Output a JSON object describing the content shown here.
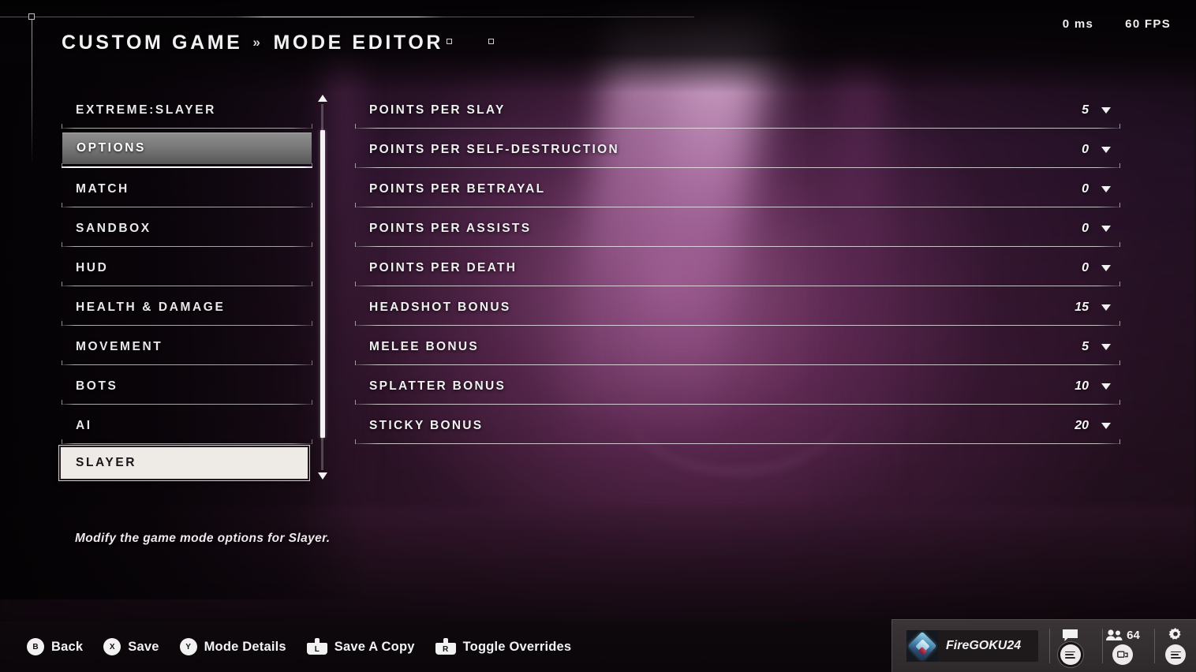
{
  "header": {
    "breadcrumb_root": "CUSTOM GAME",
    "breadcrumb_separator": "»",
    "breadcrumb_current": "MODE EDITOR",
    "latency": "0 ms",
    "framerate": "60 FPS"
  },
  "sidebar": {
    "items": [
      {
        "label": "EXTREME:SLAYER",
        "state": "normal"
      },
      {
        "label": "OPTIONS",
        "state": "hover"
      },
      {
        "label": "MATCH",
        "state": "normal"
      },
      {
        "label": "SANDBOX",
        "state": "normal"
      },
      {
        "label": "HUD",
        "state": "normal"
      },
      {
        "label": "HEALTH & DAMAGE",
        "state": "normal"
      },
      {
        "label": "MOVEMENT",
        "state": "normal"
      },
      {
        "label": "BOTS",
        "state": "normal"
      },
      {
        "label": "AI",
        "state": "normal"
      },
      {
        "label": "SLAYER",
        "state": "selected"
      }
    ],
    "description": "Modify the game mode options for Slayer."
  },
  "options": {
    "rows": [
      {
        "label": "POINTS PER SLAY",
        "value": "5"
      },
      {
        "label": "POINTS PER SELF-DESTRUCTION",
        "value": "0"
      },
      {
        "label": "POINTS PER BETRAYAL",
        "value": "0"
      },
      {
        "label": "POINTS PER ASSISTS",
        "value": "0"
      },
      {
        "label": "POINTS PER DEATH",
        "value": "0"
      },
      {
        "label": "HEADSHOT BONUS",
        "value": "15"
      },
      {
        "label": "MELEE BONUS",
        "value": "5"
      },
      {
        "label": "SPLATTER BONUS",
        "value": "10"
      },
      {
        "label": "STICKY BONUS",
        "value": "20"
      }
    ]
  },
  "action_bar": {
    "prompts": [
      {
        "button": "B",
        "type": "face",
        "label": "Back"
      },
      {
        "button": "X",
        "type": "face",
        "label": "Save"
      },
      {
        "button": "Y",
        "type": "face",
        "label": "Mode Details"
      },
      {
        "button": "L",
        "type": "trigger",
        "label": "Save A Copy"
      },
      {
        "button": "R",
        "type": "trigger",
        "label": "Toggle Overrides"
      }
    ]
  },
  "player_card": {
    "gamertag": "FireGOKU24",
    "friends_count": "64",
    "icons": {
      "chat": "chat-icon",
      "friends": "friends-icon",
      "settings": "gear-icon"
    }
  },
  "colors": {
    "accent_white": "#f2f2f2",
    "selected_bg": "#eeeae6",
    "hover_bg": "#7b7b7b",
    "background_magenta": "#7a2d69",
    "bottom_bar": "#0e090c",
    "player_card_bg": "#322e30"
  }
}
